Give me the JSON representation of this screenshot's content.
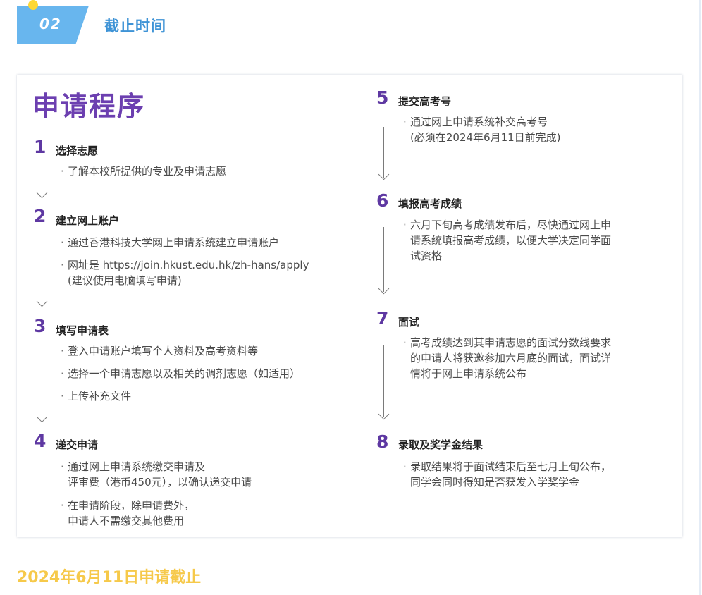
{
  "header": {
    "number": "02",
    "title": "截止时间"
  },
  "card": {
    "title": "申请程序",
    "steps": [
      {
        "num": "1",
        "title": "选择志愿",
        "bullets": [
          [
            "了解本校所提供的专业及申请志愿"
          ]
        ]
      },
      {
        "num": "2",
        "title": "建立网上账户",
        "bullets": [
          [
            "通过香港科技大学网上申请系统建立申请账户"
          ],
          [
            "网址是 https://join.hkust.edu.hk/zh-hans/apply",
            "(建议使用电脑填写申请)"
          ]
        ]
      },
      {
        "num": "3",
        "title": "填写申请表",
        "bullets": [
          [
            "登入申请账户填写个人资料及高考资料等"
          ],
          [
            "选择一个申请志愿以及相关的调剂志愿（如适用）"
          ],
          [
            "上传补充文件"
          ]
        ]
      },
      {
        "num": "4",
        "title": "递交申请",
        "bullets": [
          [
            "通过网上申请系统缴交申请及",
            "评审费（港币450元），以确认递交申请"
          ],
          [
            "在申请阶段，除申请费外，",
            "申请人不需缴交其他费用"
          ]
        ]
      },
      {
        "num": "5",
        "title": "提交高考号",
        "bullets": [
          [
            "通过网上申请系统补交高考号",
            "(必须在2024年6月11日前完成)"
          ]
        ]
      },
      {
        "num": "6",
        "title": "填报高考成绩",
        "bullets": [
          [
            "六月下旬高考成绩发布后，尽快通过网上申",
            "请系统填报高考成绩，以便大学决定同学面",
            "试资格"
          ]
        ]
      },
      {
        "num": "7",
        "title": "面试",
        "bullets": [
          [
            "高考成绩达到其申请志愿的面试分数线要求",
            "的申请人将获邀参加六月底的面试，面试详",
            "情将于网上申请系统公布"
          ]
        ]
      },
      {
        "num": "8",
        "title": "录取及奖学金结果",
        "bullets": [
          [
            "录取结果将于面试结束后至七月上旬公布，",
            "同学会同时得知是否获发入学奖学金"
          ]
        ]
      }
    ]
  },
  "footer": {
    "deadline": "2024年6月11日申请截止"
  },
  "colors": {
    "accent_blue": "#68b6ee",
    "title_blue": "#3e93d6",
    "purple": "#6c3fb0",
    "deadline_yellow": "#f6c94a"
  }
}
